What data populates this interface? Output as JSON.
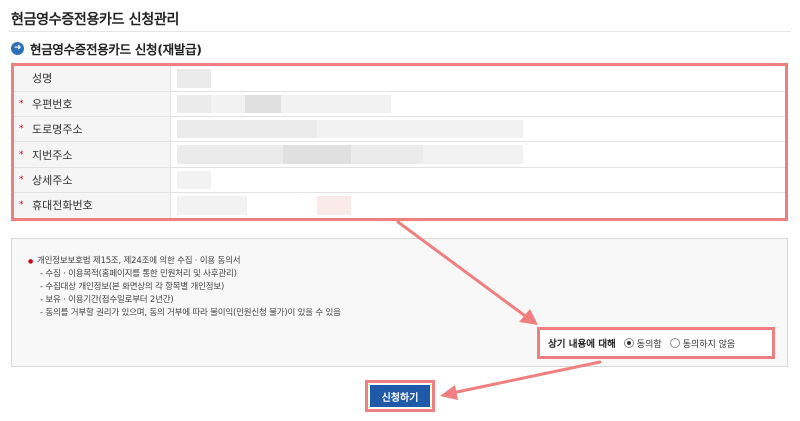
{
  "page": {
    "title": "현금영수증전용카드 신청관리"
  },
  "section": {
    "title": "현금영수증전용카드 신청(재발급)"
  },
  "form": {
    "rows": [
      {
        "label": "성명",
        "required": false
      },
      {
        "label": "우편번호",
        "required": true
      },
      {
        "label": "도로명주소",
        "required": true
      },
      {
        "label": "지번주소",
        "required": true
      },
      {
        "label": "상세주소",
        "required": true
      },
      {
        "label": "휴대전화번호",
        "required": true
      }
    ],
    "required_mark": "*"
  },
  "consent": {
    "heading": "개인정보보호법 제15조, 제24조에 의한 수집 · 이용 동의서",
    "items": [
      "- 수집 · 이용목적(홈페이지를 통한 민원처리 및 사후관리)",
      "- 수집대상 개인정보(본 화면상의 각 항목별 개인정보)",
      "- 보유 · 이용기간(접수일로부터 2년간)",
      "- 동의를 거부할 권리가 있으며, 동의   거부에 따라 불이익(민원신청 불가)이 있을 수 있음"
    ]
  },
  "agree": {
    "label": "상기 내용에 대해",
    "options": [
      "동의함",
      "동의하지 않음"
    ],
    "selected": "동의함"
  },
  "submit": {
    "label": "신청하기"
  },
  "colors": {
    "highlight": "#f08080",
    "primary": "#1e5aa8",
    "required": "#d0021b"
  }
}
